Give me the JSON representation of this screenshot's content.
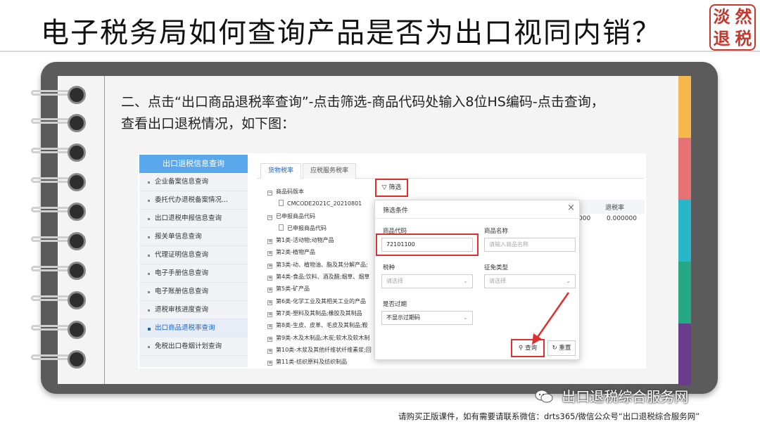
{
  "slide": {
    "title": "电子税务局如何查询产品是否为出口视同内销？",
    "seal_chars": [
      "淡",
      "然",
      "退",
      "税"
    ],
    "instruction_line1": "二、点击“出口商品退税率查询”-点击筛选-商品代码处输入8位HS编码-点击查询，",
    "instruction_line2": "查看出口退税情况，如下图：",
    "tab_colors": [
      "#f5b84a",
      "#e57373",
      "#29b6c9",
      "#26a884",
      "#6a3d8c"
    ]
  },
  "left_nav": {
    "header": "出口退税信息查询",
    "items": [
      {
        "label": "企业备案信息查询"
      },
      {
        "label": "委托代办退税备案情况..."
      },
      {
        "label": "出口退税申报信息查询"
      },
      {
        "label": "报关单信息查询"
      },
      {
        "label": "代理证明信息查询"
      },
      {
        "label": "电子手册信息查询"
      },
      {
        "label": "电子账册信息查询"
      },
      {
        "label": "退税审核进度查询"
      },
      {
        "label": "出口商品退税率查询",
        "active": true
      },
      {
        "label": "免税出口卷烟计划查询"
      }
    ]
  },
  "tabs": {
    "goods_rate": "货物税率",
    "service_rate": "应税服务税率"
  },
  "tree": {
    "items": [
      {
        "label": "商品码版本",
        "kind": "minus"
      },
      {
        "label": "CMCODE2021C_20210801",
        "kind": "file"
      },
      {
        "label": "已申报商品代码",
        "kind": "minus"
      },
      {
        "label": "已申报商品代码",
        "kind": "file"
      },
      {
        "label": "第1类-活动物;动物产品",
        "kind": "plus"
      },
      {
        "label": "第2类-植物产品",
        "kind": "plus"
      },
      {
        "label": "第3类-动、植物油、脂及其分解产品;",
        "kind": "plus"
      },
      {
        "label": "第4类-食品;饮料、酒及醋;烟草、烟草",
        "kind": "plus"
      },
      {
        "label": "第5类-矿产品",
        "kind": "plus"
      },
      {
        "label": "第6类-化学工业及其相关工业的产品",
        "kind": "plus"
      },
      {
        "label": "第7类-塑料及其制品;橡胶及其制品",
        "kind": "plus"
      },
      {
        "label": "第8类-生皮、皮革、毛皮及其制品;鞍",
        "kind": "plus"
      },
      {
        "label": "第9类-木及木制品;木炭;软木及软木制",
        "kind": "plus"
      },
      {
        "label": "第10类-木浆及其他纤维状纤维素浆;回",
        "kind": "plus"
      },
      {
        "label": "第11类-纺织原料及纺织制品",
        "kind": "plus"
      }
    ]
  },
  "toolbar": {
    "filter_label": "筛选"
  },
  "table": {
    "header_rate": "退税率",
    "cell_partial": "000",
    "cell_rate": "0.000000"
  },
  "modal": {
    "title": "筛选条件",
    "code_label": "商品代码",
    "code_value": "72101100",
    "name_label": "商品名称",
    "name_placeholder": "请输入商品名称",
    "tax_type_label": "税种",
    "tax_type_placeholder": "请选择",
    "levy_type_label": "征免类型",
    "levy_type_placeholder": "请选择",
    "expired_label": "是否过期",
    "expired_value": "不显示过期码",
    "query_label": "查询",
    "reset_label": "重置"
  },
  "footer": {
    "watermark": "出口退税综合服务网",
    "notice": "请购买正版课件，如有需要请联系微信：drts365/微信公众号“出口退税综合服务网”"
  }
}
